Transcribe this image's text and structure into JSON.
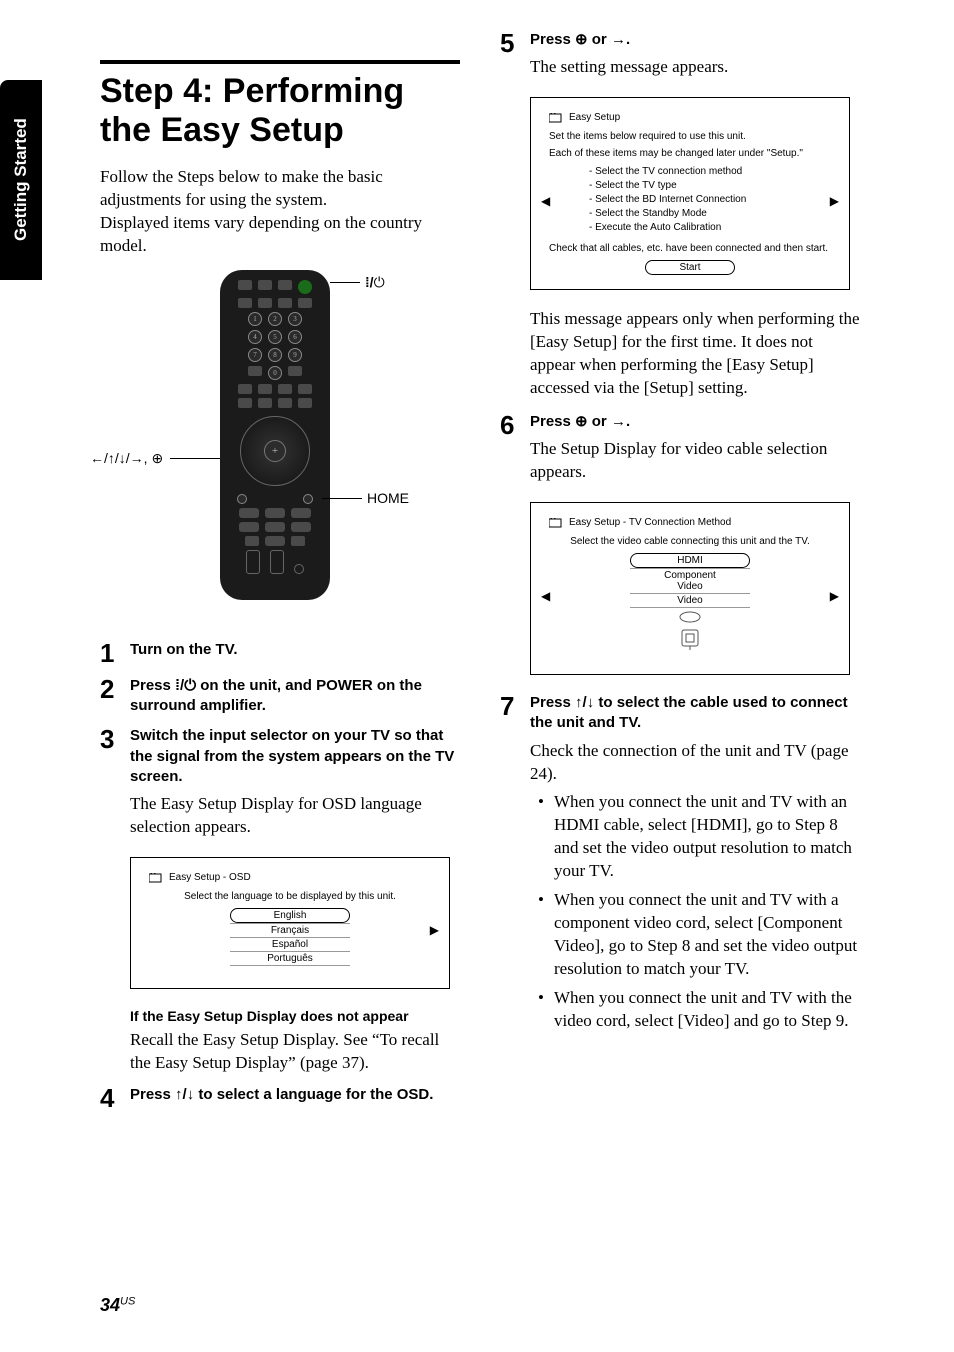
{
  "sideTab": "Getting Started",
  "heading": "Step 4: Performing the Easy Setup",
  "intro": "Follow the Steps below to make the basic adjustments for using the system.\nDisplayed items vary depending on the country model.",
  "remoteLabels": {
    "power": "⏻",
    "arrows": "←/↑/↓/→, ⊕",
    "home": "HOME"
  },
  "steps": {
    "s1": {
      "num": "1",
      "instr": "Turn on the TV."
    },
    "s2": {
      "num": "2",
      "instr_a": "Press ",
      "instr_sym": "⏻",
      "instr_b": " on the unit, and POWER on the surround amplifier."
    },
    "s3": {
      "num": "3",
      "instr": "Switch the input selector on your TV so that the signal from the system appears on the TV screen.",
      "desc": "The Easy Setup Display for OSD language selection appears."
    },
    "s3_subhead": "If the Easy Setup Display does not appear",
    "s3_subpara": "Recall the Easy Setup Display. See “To recall the Easy Setup Display” (page 37).",
    "s4": {
      "num": "4",
      "instr": "Press ↑/↓ to select a language for the OSD."
    },
    "s5": {
      "num": "5",
      "instr": "Press ⊕ or →.",
      "desc": "The setting message appears.",
      "note": "This message appears only when performing the [Easy Setup] for the first time. It does not appear when performing the [Easy Setup] accessed via the [Setup] setting."
    },
    "s6": {
      "num": "6",
      "instr": "Press ⊕ or →.",
      "desc": "The Setup Display for video cable selection appears."
    },
    "s7": {
      "num": "7",
      "instr": "Press ↑/↓ to select the cable used to connect the unit and TV.",
      "desc": "Check the connection of the unit and TV (page 24).",
      "bullets": [
        "When you connect the unit and TV with an HDMI cable, select [HDMI], go to Step 8 and set the video output resolution to match your TV.",
        "When you connect the unit and TV with a component video cord, select [Component Video], go to Step 8 and set the video output resolution to match your TV.",
        "When you connect the unit and TV with the video cord, select [Video] and go to Step 9."
      ]
    }
  },
  "osd1": {
    "title": "Easy Setup - OSD",
    "msg": "Select the language to be displayed by this unit.",
    "options": [
      "English",
      "Français",
      "Español",
      "Português"
    ]
  },
  "osd2": {
    "title": "Easy Setup",
    "msg1": "Set the items below required to use this unit.",
    "msg2": "Each of these items may be changed later under \"Setup.\"",
    "items": [
      "- Select the TV connection method",
      "- Select the TV type",
      "- Select the BD Internet Connection",
      "- Select the Standby Mode",
      "- Execute the Auto Calibration"
    ],
    "foot": "Check that all cables, etc. have been connected and then start.",
    "button": "Start"
  },
  "osd3": {
    "title": "Easy Setup - TV Connection Method",
    "msg": "Select the video cable connecting this unit and the TV.",
    "options": [
      "HDMI",
      "Component Video",
      "Video"
    ]
  },
  "page": {
    "num": "34",
    "region": "US"
  }
}
